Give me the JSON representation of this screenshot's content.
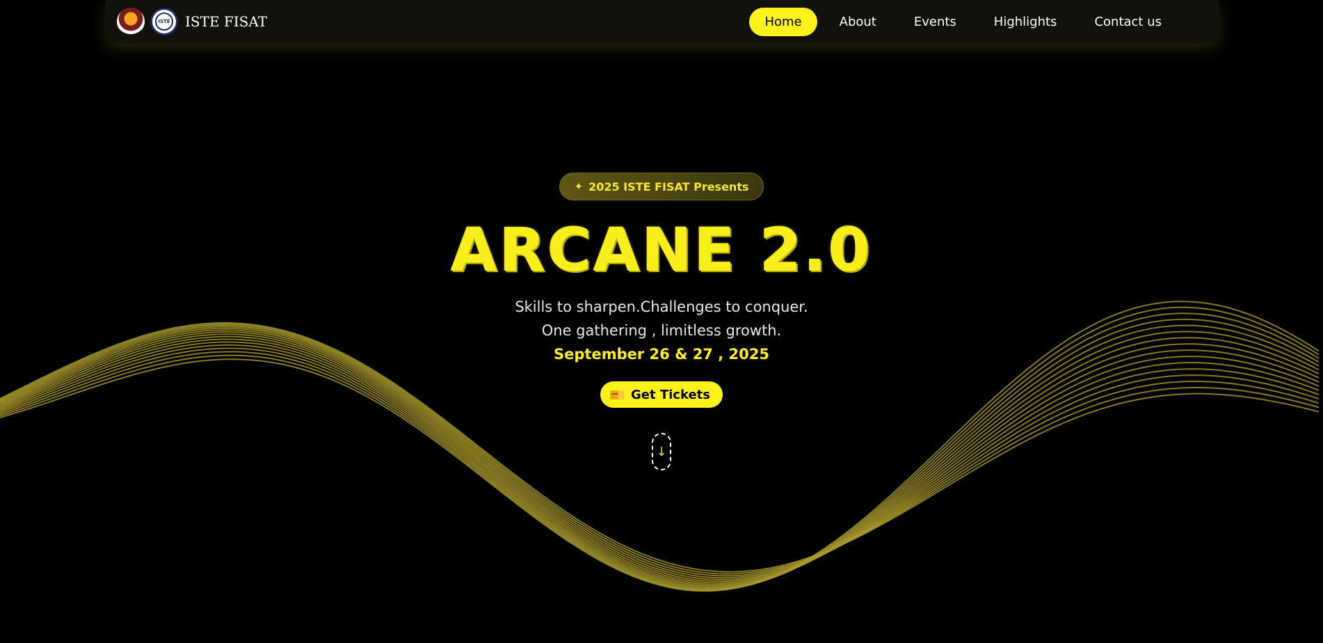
{
  "nav": {
    "brand_text": "ISTE FISAT",
    "logo_b_text": "ISTE",
    "items": [
      {
        "label": "Home",
        "active": true
      },
      {
        "label": "About",
        "active": false
      },
      {
        "label": "Events",
        "active": false
      },
      {
        "label": "Highlights",
        "active": false
      },
      {
        "label": "Contact us",
        "active": false
      }
    ]
  },
  "hero": {
    "badge_icon": "✦",
    "badge_text": "2025 ISTE FISAT Presents",
    "title": "ARCANE 2.0",
    "tagline_line1": "Skills to sharpen.Challenges to conquer.",
    "tagline_line2": "One gathering , limitless growth.",
    "date": "September 26 & 27 , 2025",
    "cta_label": "Get Tickets",
    "scroll_icon": "↓"
  },
  "colors": {
    "accent": "#fff21a",
    "wave": "#a8982a",
    "background": "#000000"
  }
}
